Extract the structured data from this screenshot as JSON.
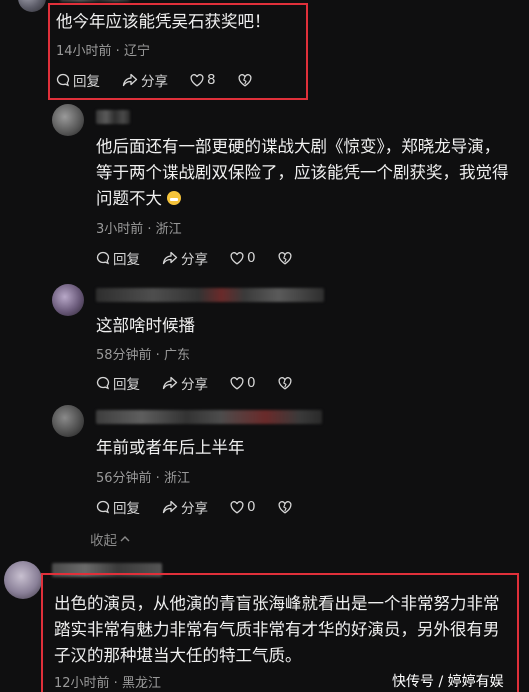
{
  "comments": [
    {
      "content": "他今年应该能凭吴石获奖吧！",
      "meta": "14小时前 · 辽宁",
      "reply": "回复",
      "share": "分享",
      "likes": "8"
    },
    {
      "content_lines": [
        "他后面还有一部更硬的谍战大剧《惊变》，郑晓龙导演，",
        "等于两个谍战剧双保险了，应该能凭一个剧获奖，我觉得",
        "问题不大"
      ],
      "meta": "3小时前 · 浙江",
      "reply": "回复",
      "share": "分享",
      "likes": "0"
    },
    {
      "content": "这部啥时候播",
      "meta": "58分钟前 · 广东",
      "reply": "回复",
      "share": "分享",
      "likes": "0"
    },
    {
      "content": "年前或者年后上半年",
      "meta": "56分钟前 · 浙江",
      "reply": "回复",
      "share": "分享",
      "likes": "0"
    },
    {
      "content_lines": [
        "出色的演员，从他演的青盲张海峰就看出是一个非常努力非常",
        "踏实非常有魅力非常有气质非常有才华的好演员，另外很有男",
        "子汉的那种堪当大任的特工气质。"
      ],
      "meta": "12小时前 · 黑龙江"
    }
  ],
  "collapse_label": "收起",
  "watermark": "快传号 / 婷婷有娱",
  "colors": {
    "highlight": "#e0303a",
    "background": "#0f0f10"
  }
}
